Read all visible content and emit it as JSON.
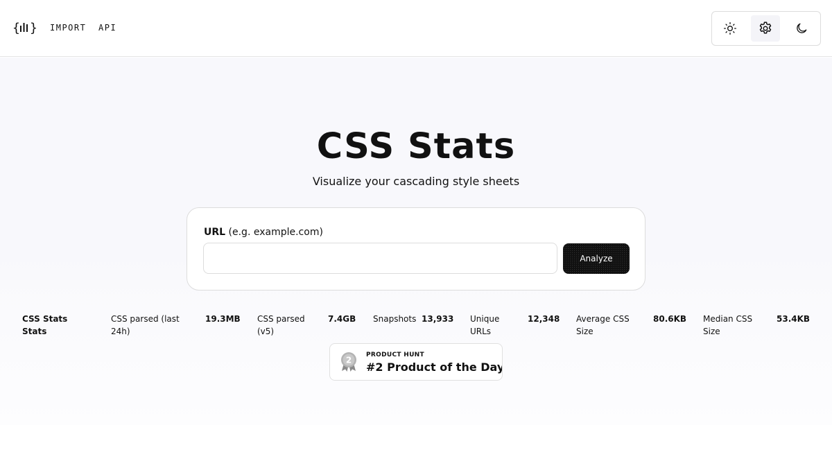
{
  "header": {
    "logo_icon": "chart-bars-braces-icon",
    "nav": [
      {
        "label": "IMPORT"
      },
      {
        "label": "API"
      }
    ],
    "theme_switch": {
      "icons": [
        "sun-icon",
        "gear-icon",
        "moon-icon"
      ],
      "selected": "gear-icon"
    }
  },
  "hero": {
    "title": "CSS Stats",
    "subtitle": "Visualize your cascading style sheets"
  },
  "form": {
    "label_strong": "URL",
    "label_hint": "(e.g. example.com)",
    "input_value": "",
    "input_placeholder": "",
    "button_label": "Analyze"
  },
  "stats": {
    "title": "CSS Stats Stats",
    "items": [
      {
        "label": "CSS parsed (last 24h)",
        "value": "19.3MB"
      },
      {
        "label": "CSS parsed (v5)",
        "value": "7.4GB"
      },
      {
        "label": "Snapshots",
        "value": "13,933"
      },
      {
        "label": "Unique URLs",
        "value": "12,348"
      },
      {
        "label": "Average CSS Size",
        "value": "80.6KB"
      },
      {
        "label": "Median CSS Size",
        "value": "53.4KB"
      }
    ]
  },
  "badge": {
    "icon": "medal-icon",
    "medal_number": "2",
    "small": "PRODUCT HUNT",
    "big": "#2 Product of the Day"
  },
  "colors": {
    "text": "#111111",
    "button_bg": "#111111",
    "hero_bg": "#f8f8fc",
    "border": "#dcdcdc"
  }
}
